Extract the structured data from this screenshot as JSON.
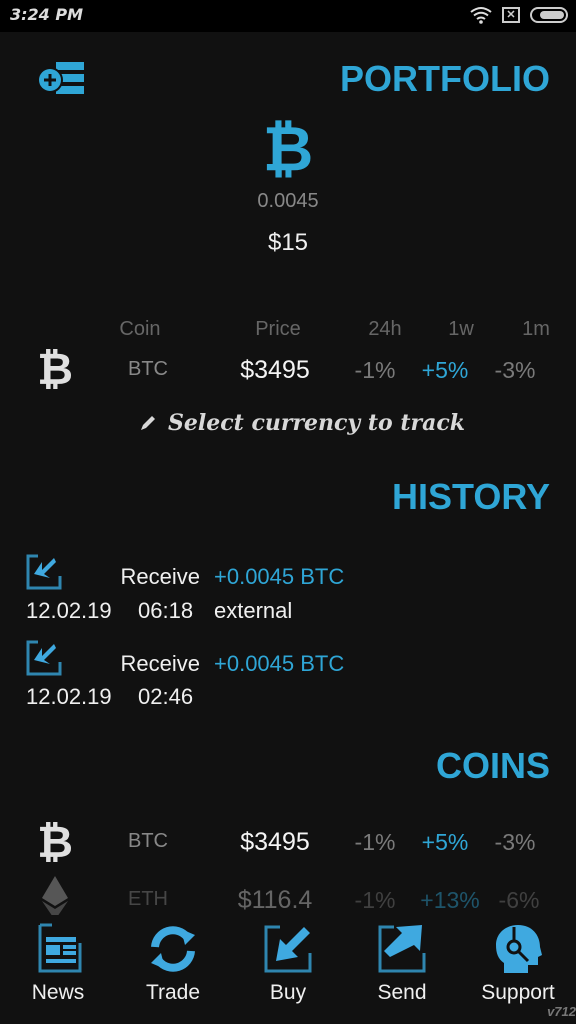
{
  "status_bar": {
    "time": "3:24 PM",
    "icons": [
      "wifi-icon",
      "no-sim-icon",
      "battery-icon"
    ]
  },
  "portfolio": {
    "title": "PORTFOLIO",
    "add_button_icon": "add-list-icon",
    "coin_icon": "bitcoin-icon",
    "amount": "0.0045",
    "usd_value": "$15"
  },
  "tracker": {
    "headers": {
      "coin": "Coin",
      "price": "Price",
      "h24": "24h",
      "w1": "1w",
      "m1": "1m"
    },
    "row": {
      "symbol": "BTC",
      "price": "$3495",
      "h24": "-1%",
      "w1": "+5%",
      "m1": "-3%"
    },
    "select_label": "Select currency to track"
  },
  "history": {
    "title": "HISTORY",
    "items": [
      {
        "type": "Receive",
        "amount": "+0.0045 BTC",
        "date": "12.02.19",
        "time": "06:18",
        "note": "external"
      },
      {
        "type": "Receive",
        "amount": "+0.0045 BTC",
        "date": "12.02.19",
        "time": "02:46",
        "note": ""
      }
    ]
  },
  "coins": {
    "title": "COINS",
    "items": [
      {
        "symbol": "BTC",
        "icon": "bitcoin-icon",
        "price": "$3495",
        "h24": "-1%",
        "w1": "+5%",
        "m1": "-3%"
      },
      {
        "symbol": "ETH",
        "icon": "ethereum-icon",
        "price": "$116.4",
        "h24": "-1%",
        "w1": "+13%",
        "m1": "-6%"
      }
    ]
  },
  "nav": [
    {
      "label": "News",
      "icon": "news-icon"
    },
    {
      "label": "Trade",
      "icon": "trade-icon"
    },
    {
      "label": "Buy",
      "icon": "buy-icon"
    },
    {
      "label": "Send",
      "icon": "send-icon"
    },
    {
      "label": "Support",
      "icon": "support-icon"
    }
  ],
  "version": "v712",
  "colors": {
    "accent": "#2fa6d6",
    "background": "#111111",
    "muted": "#7a7a7a"
  }
}
